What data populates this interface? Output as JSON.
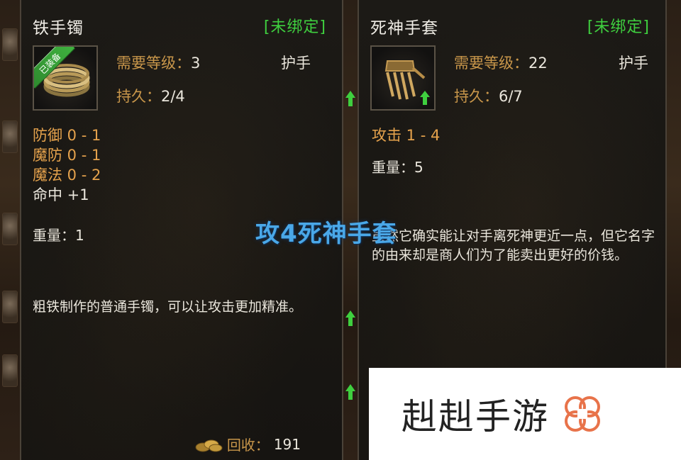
{
  "item1": {
    "name": "铁手镯",
    "bind_status": "[未绑定]",
    "ribbon": "已装备",
    "icon": "bracelet-icon",
    "level_label": "需要等级：",
    "level_value": "3",
    "slot_type": "护手",
    "durability_label": "持久：",
    "durability_value": "2/4",
    "stats": [
      "防御 0 - 1",
      "魔防 0 - 1",
      "魔法 0 - 2"
    ],
    "accuracy": "命中 +1",
    "weight": "重量：1",
    "description": "粗铁制作的普通手镯，可以让攻击更加精准。",
    "recycle_label": "回收：",
    "recycle_value": "191"
  },
  "item2": {
    "name": "死神手套",
    "bind_status": "[未绑定]",
    "icon": "gauntlet-icon",
    "level_label": "需要等级：",
    "level_value": "22",
    "slot_type": "护手",
    "durability_label": "持久：",
    "durability_value": "6/7",
    "attack": "攻击 1 - 4",
    "weight": "重量：5",
    "description": "虽然它确实能让对手离死神更近一点，但它名字的由来却是商人们为了能卖出更好的价钱。"
  },
  "overlay_title": "攻4死神手套",
  "watermark": "赳赳手游",
  "colors": {
    "bind_green": "#3fcf3f",
    "gold_label": "#c8964a",
    "stat_orange": "#e5a24c",
    "overlay_blue": "#4aa8e8",
    "watermark_flower": "#e8734a"
  }
}
